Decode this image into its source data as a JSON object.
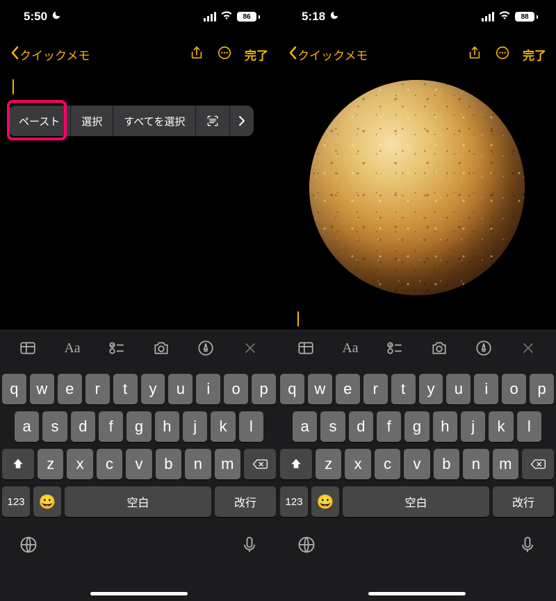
{
  "accent": "#f7b500",
  "left": {
    "status": {
      "time": "5:50",
      "battery": "86"
    },
    "nav": {
      "back": "クイックメモ",
      "done": "完了"
    },
    "menu": {
      "paste": "ペースト",
      "select": "選択",
      "selectAll": "すべてを選択"
    }
  },
  "right": {
    "status": {
      "time": "5:18",
      "battery": "88"
    },
    "nav": {
      "back": "クイックメモ",
      "done": "完了"
    }
  },
  "toolbar": {
    "aa": "Aa"
  },
  "keyboard": {
    "row1": [
      "q",
      "w",
      "e",
      "r",
      "t",
      "y",
      "u",
      "i",
      "o",
      "p"
    ],
    "row2": [
      "a",
      "s",
      "d",
      "f",
      "g",
      "h",
      "j",
      "k",
      "l"
    ],
    "row3": [
      "z",
      "x",
      "c",
      "v",
      "b",
      "n",
      "m"
    ],
    "num": "123",
    "space": "空白",
    "return": "改行"
  }
}
